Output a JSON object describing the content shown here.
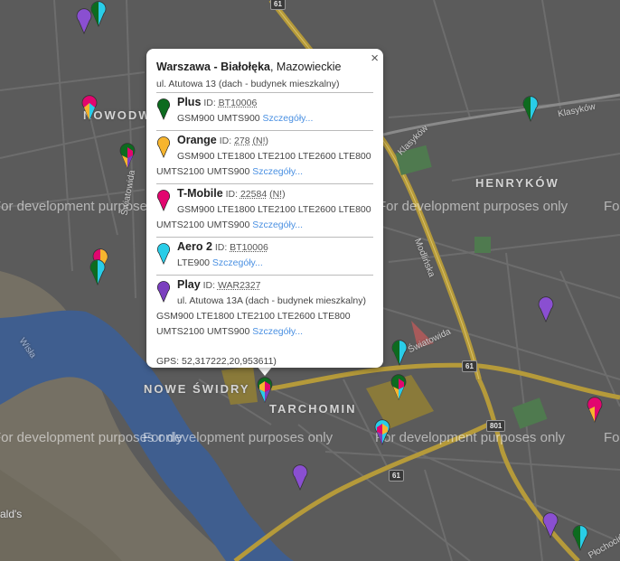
{
  "watermark": "For development purposes only",
  "districts": {
    "nowodwory": "NOWODWORY",
    "henrykow": "HENRYKÓW",
    "nowe_swidry": "NOWE ŚWIDRY",
    "tarchomin": "TARCHOMIN"
  },
  "streets": {
    "swiatowida_1": "Światowida",
    "swiatowida_2": "Światowida",
    "modlinska": "Modlińska",
    "klaskow_1": "Klasyków",
    "klaskow_2": "Klasyków",
    "wisla": "Wisła",
    "plochocinska": "Płochocińska",
    "mcdonalds": "ald's"
  },
  "road_shields": [
    "61",
    "61",
    "801",
    "61"
  ],
  "popup": {
    "city": "Warszawa - Białołęka",
    "region": ", Mazowieckie",
    "address": "ul. Atutowa 13 (dach - budynek mieszkalny)",
    "close": "×",
    "operators": [
      {
        "name": "Plus",
        "id_label": "ID:",
        "id": "BT10006",
        "note": "",
        "color": "#0d6b1f",
        "lines": [
          "GSM900 UMTS900"
        ],
        "details": "Szczegóły..."
      },
      {
        "name": "Orange",
        "id_label": "ID:",
        "id": "278",
        "note": "(N!)",
        "color": "#f7b52e",
        "lines": [
          "GSM900 LTE1800 LTE2100 LTE2600 LTE800",
          "UMTS2100 UMTS900"
        ],
        "details": "Szczegóły..."
      },
      {
        "name": "T-Mobile",
        "id_label": "ID:",
        "id": "22584",
        "note": "(N!)",
        "color": "#e2066f",
        "lines": [
          "GSM900 LTE1800 LTE2100 LTE2600 LTE800",
          "UMTS2100 UMTS900"
        ],
        "details": "Szczegóły..."
      },
      {
        "name": "Aero 2",
        "id_label": "ID:",
        "id": "BT10006",
        "note": "",
        "color": "#29cde8",
        "lines": [
          "LTE900"
        ],
        "details": "Szczegóły..."
      },
      {
        "name": "Play",
        "id_label": "ID:",
        "id": "WAR2327",
        "note": "",
        "color": "#7b3fbf",
        "address": "ul. Atutowa 13A (dach - budynek mieszkalny)",
        "lines": [
          "GSM900 LTE1800 LTE2100 LTE2600 LTE800",
          "UMTS2100 UMTS900"
        ],
        "details": "Szczegóły..."
      }
    ],
    "gps": "GPS: 52,317222,20,953611)"
  },
  "colors": {
    "map_bg": "#5b5b5b",
    "river": "#3f5e8f",
    "road_major": "#b59a3a",
    "park": "#4f7a4f"
  }
}
